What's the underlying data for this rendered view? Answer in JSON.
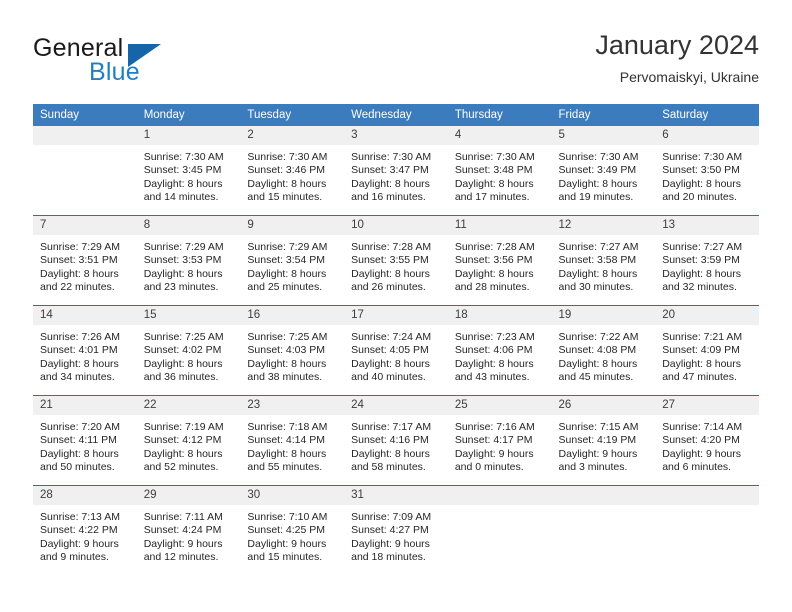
{
  "brand": {
    "word1": "General",
    "word2": "Blue",
    "triangle_color": "#1565a8",
    "blue_color": "#1f7fc4"
  },
  "header": {
    "title": "January 2024",
    "subtitle": "Pervomaiskyi, Ukraine"
  },
  "theme": {
    "header_row_bg": "#3a7cbe",
    "daynum_bg": "#f0f0f0",
    "row_divider": "#2f6fae"
  },
  "weekday_headers": [
    "Sunday",
    "Monday",
    "Tuesday",
    "Wednesday",
    "Thursday",
    "Friday",
    "Saturday"
  ],
  "weeks": [
    [
      {
        "day": "",
        "lines": []
      },
      {
        "day": "1",
        "lines": [
          "Sunrise: 7:30 AM",
          "Sunset: 3:45 PM",
          "Daylight: 8 hours",
          "and 14 minutes."
        ]
      },
      {
        "day": "2",
        "lines": [
          "Sunrise: 7:30 AM",
          "Sunset: 3:46 PM",
          "Daylight: 8 hours",
          "and 15 minutes."
        ]
      },
      {
        "day": "3",
        "lines": [
          "Sunrise: 7:30 AM",
          "Sunset: 3:47 PM",
          "Daylight: 8 hours",
          "and 16 minutes."
        ]
      },
      {
        "day": "4",
        "lines": [
          "Sunrise: 7:30 AM",
          "Sunset: 3:48 PM",
          "Daylight: 8 hours",
          "and 17 minutes."
        ]
      },
      {
        "day": "5",
        "lines": [
          "Sunrise: 7:30 AM",
          "Sunset: 3:49 PM",
          "Daylight: 8 hours",
          "and 19 minutes."
        ]
      },
      {
        "day": "6",
        "lines": [
          "Sunrise: 7:30 AM",
          "Sunset: 3:50 PM",
          "Daylight: 8 hours",
          "and 20 minutes."
        ]
      }
    ],
    [
      {
        "day": "7",
        "lines": [
          "Sunrise: 7:29 AM",
          "Sunset: 3:51 PM",
          "Daylight: 8 hours",
          "and 22 minutes."
        ]
      },
      {
        "day": "8",
        "lines": [
          "Sunrise: 7:29 AM",
          "Sunset: 3:53 PM",
          "Daylight: 8 hours",
          "and 23 minutes."
        ]
      },
      {
        "day": "9",
        "lines": [
          "Sunrise: 7:29 AM",
          "Sunset: 3:54 PM",
          "Daylight: 8 hours",
          "and 25 minutes."
        ]
      },
      {
        "day": "10",
        "lines": [
          "Sunrise: 7:28 AM",
          "Sunset: 3:55 PM",
          "Daylight: 8 hours",
          "and 26 minutes."
        ]
      },
      {
        "day": "11",
        "lines": [
          "Sunrise: 7:28 AM",
          "Sunset: 3:56 PM",
          "Daylight: 8 hours",
          "and 28 minutes."
        ]
      },
      {
        "day": "12",
        "lines": [
          "Sunrise: 7:27 AM",
          "Sunset: 3:58 PM",
          "Daylight: 8 hours",
          "and 30 minutes."
        ]
      },
      {
        "day": "13",
        "lines": [
          "Sunrise: 7:27 AM",
          "Sunset: 3:59 PM",
          "Daylight: 8 hours",
          "and 32 minutes."
        ]
      }
    ],
    [
      {
        "day": "14",
        "lines": [
          "Sunrise: 7:26 AM",
          "Sunset: 4:01 PM",
          "Daylight: 8 hours",
          "and 34 minutes."
        ]
      },
      {
        "day": "15",
        "lines": [
          "Sunrise: 7:25 AM",
          "Sunset: 4:02 PM",
          "Daylight: 8 hours",
          "and 36 minutes."
        ]
      },
      {
        "day": "16",
        "lines": [
          "Sunrise: 7:25 AM",
          "Sunset: 4:03 PM",
          "Daylight: 8 hours",
          "and 38 minutes."
        ]
      },
      {
        "day": "17",
        "lines": [
          "Sunrise: 7:24 AM",
          "Sunset: 4:05 PM",
          "Daylight: 8 hours",
          "and 40 minutes."
        ]
      },
      {
        "day": "18",
        "lines": [
          "Sunrise: 7:23 AM",
          "Sunset: 4:06 PM",
          "Daylight: 8 hours",
          "and 43 minutes."
        ]
      },
      {
        "day": "19",
        "lines": [
          "Sunrise: 7:22 AM",
          "Sunset: 4:08 PM",
          "Daylight: 8 hours",
          "and 45 minutes."
        ]
      },
      {
        "day": "20",
        "lines": [
          "Sunrise: 7:21 AM",
          "Sunset: 4:09 PM",
          "Daylight: 8 hours",
          "and 47 minutes."
        ]
      }
    ],
    [
      {
        "day": "21",
        "lines": [
          "Sunrise: 7:20 AM",
          "Sunset: 4:11 PM",
          "Daylight: 8 hours",
          "and 50 minutes."
        ]
      },
      {
        "day": "22",
        "lines": [
          "Sunrise: 7:19 AM",
          "Sunset: 4:12 PM",
          "Daylight: 8 hours",
          "and 52 minutes."
        ]
      },
      {
        "day": "23",
        "lines": [
          "Sunrise: 7:18 AM",
          "Sunset: 4:14 PM",
          "Daylight: 8 hours",
          "and 55 minutes."
        ]
      },
      {
        "day": "24",
        "lines": [
          "Sunrise: 7:17 AM",
          "Sunset: 4:16 PM",
          "Daylight: 8 hours",
          "and 58 minutes."
        ]
      },
      {
        "day": "25",
        "lines": [
          "Sunrise: 7:16 AM",
          "Sunset: 4:17 PM",
          "Daylight: 9 hours",
          "and 0 minutes."
        ]
      },
      {
        "day": "26",
        "lines": [
          "Sunrise: 7:15 AM",
          "Sunset: 4:19 PM",
          "Daylight: 9 hours",
          "and 3 minutes."
        ]
      },
      {
        "day": "27",
        "lines": [
          "Sunrise: 7:14 AM",
          "Sunset: 4:20 PM",
          "Daylight: 9 hours",
          "and 6 minutes."
        ]
      }
    ],
    [
      {
        "day": "28",
        "lines": [
          "Sunrise: 7:13 AM",
          "Sunset: 4:22 PM",
          "Daylight: 9 hours",
          "and 9 minutes."
        ]
      },
      {
        "day": "29",
        "lines": [
          "Sunrise: 7:11 AM",
          "Sunset: 4:24 PM",
          "Daylight: 9 hours",
          "and 12 minutes."
        ]
      },
      {
        "day": "30",
        "lines": [
          "Sunrise: 7:10 AM",
          "Sunset: 4:25 PM",
          "Daylight: 9 hours",
          "and 15 minutes."
        ]
      },
      {
        "day": "31",
        "lines": [
          "Sunrise: 7:09 AM",
          "Sunset: 4:27 PM",
          "Daylight: 9 hours",
          "and 18 minutes."
        ]
      },
      {
        "day": "",
        "lines": []
      },
      {
        "day": "",
        "lines": []
      },
      {
        "day": "",
        "lines": []
      }
    ]
  ]
}
